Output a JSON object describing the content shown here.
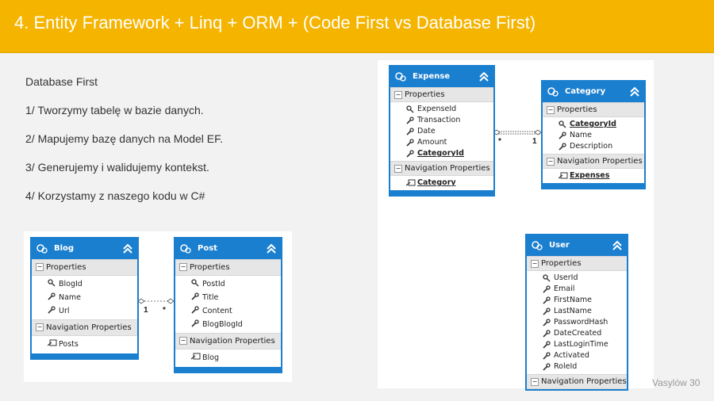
{
  "header": {
    "title": "4. Entity Framework + Linq + ORM + (Code First vs Database First)"
  },
  "content": {
    "lines": [
      "Database First",
      "1/ Tworzymy tabelę w bazie danych.",
      "2/ Mapujemy bazę danych na Model EF.",
      "3/ Generujemy i walidujemy kontekst.",
      "4/ Korzystamy z naszego kodu w C#"
    ]
  },
  "labels": {
    "properties": "Properties",
    "navigation_properties": "Navigation Properties"
  },
  "entities": {
    "expense": {
      "name": "Expense",
      "props": [
        "ExpenseId",
        "Transaction",
        "Date",
        "Amount",
        "CategoryId"
      ],
      "nav": [
        "Category"
      ]
    },
    "category": {
      "name": "Category",
      "props": [
        "CategoryId",
        "Name",
        "Description"
      ],
      "nav": [
        "Expenses"
      ]
    },
    "user": {
      "name": "User",
      "props": [
        "UserId",
        "Email",
        "FirstName",
        "LastName",
        "PasswordHash",
        "DateCreated",
        "LastLoginTime",
        "Activated",
        "RoleId"
      ]
    },
    "blog": {
      "name": "Blog",
      "props": [
        "BlogId",
        "Name",
        "Url"
      ],
      "nav": [
        "Posts"
      ]
    },
    "post": {
      "name": "Post",
      "props": [
        "PostId",
        "Title",
        "Content",
        "BlogBlogId"
      ],
      "nav": [
        "Blog"
      ]
    }
  },
  "associations": {
    "expense_category": {
      "left": "*",
      "right": "1"
    },
    "blog_post": {
      "left": "1",
      "right": "*"
    }
  },
  "footer": {
    "text": "Vasylów 30"
  },
  "colors": {
    "header": "#f4b400",
    "entity_blue": "#1b7fcf"
  }
}
